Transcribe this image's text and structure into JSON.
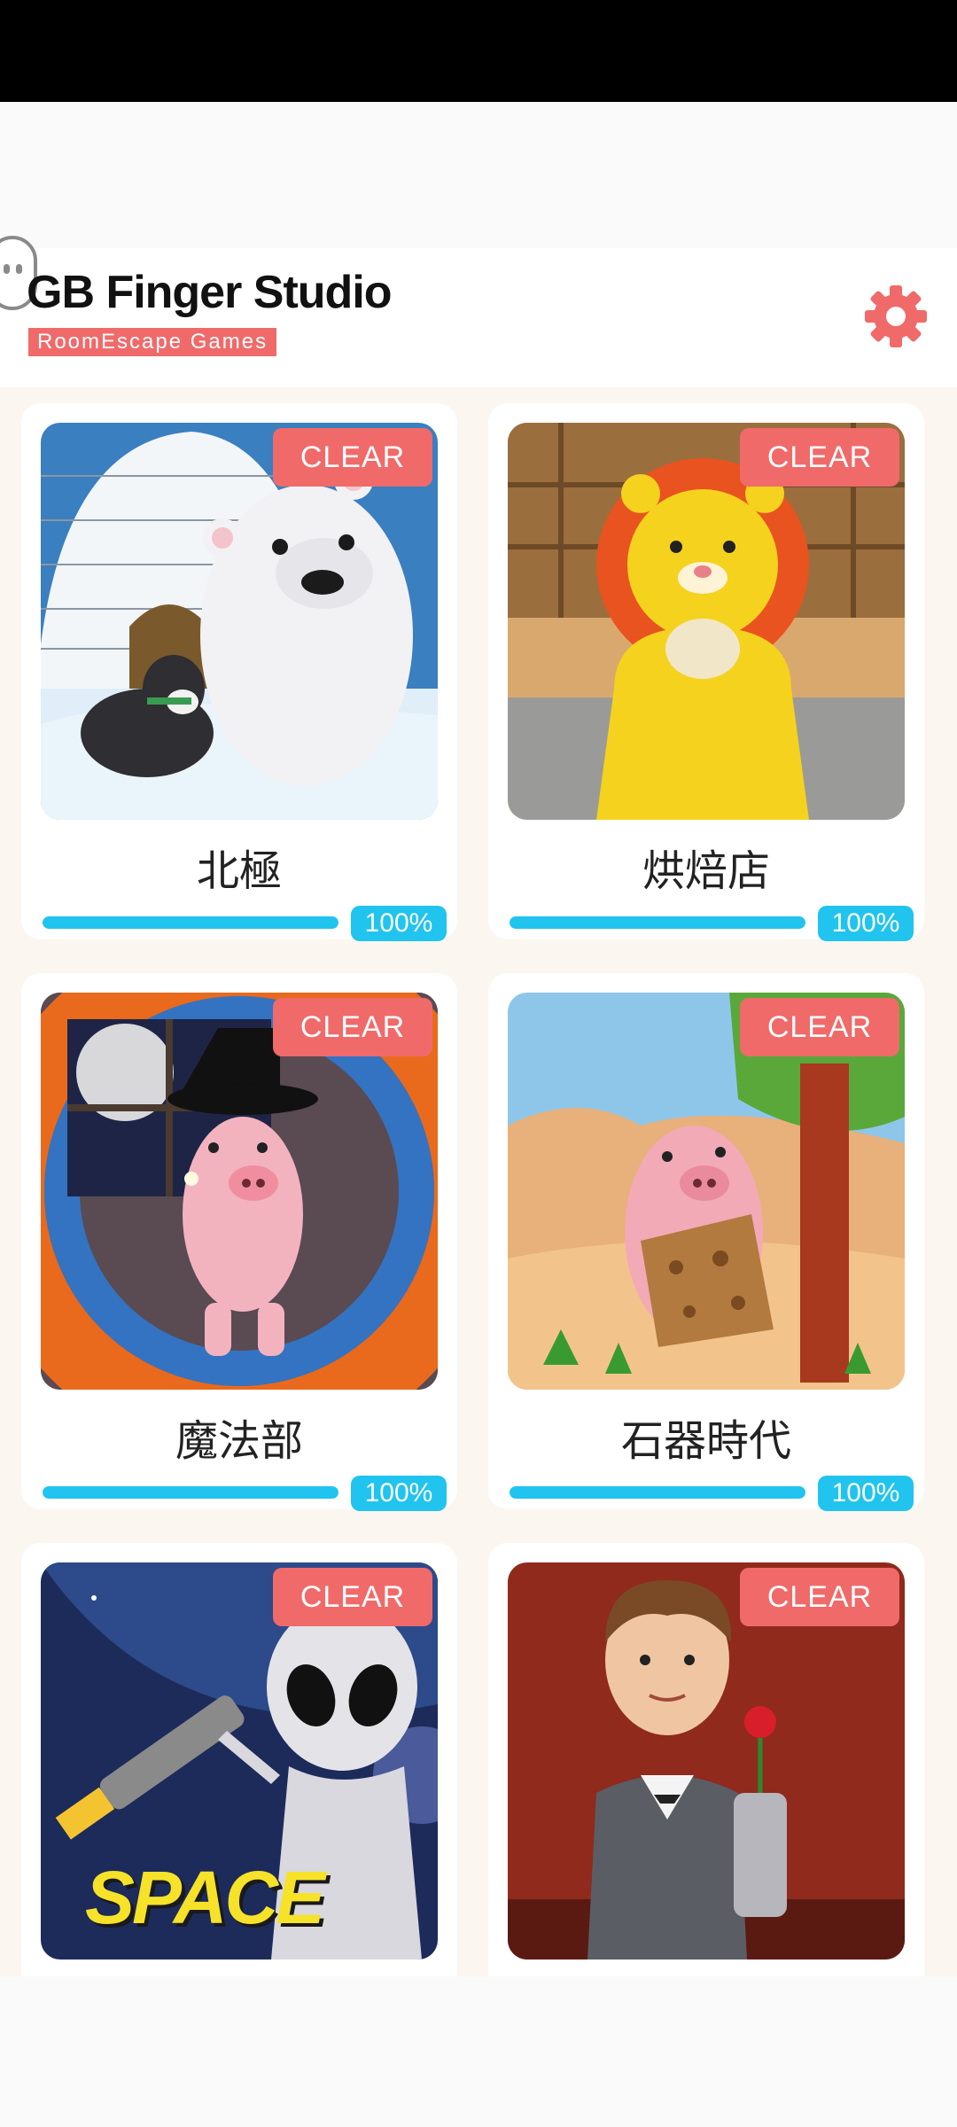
{
  "header": {
    "title": "GB Finger Studio",
    "subtitle": "RoomEscape Games",
    "settings_icon": "gear-icon",
    "accent_color": "#f06a6a"
  },
  "games": [
    {
      "title": "北極",
      "badge": "CLEAR",
      "progress_label": "100%",
      "progress": 1.0
    },
    {
      "title": "烘焙店",
      "badge": "CLEAR",
      "progress_label": "100%",
      "progress": 1.0
    },
    {
      "title": "魔法部",
      "badge": "CLEAR",
      "progress_label": "100%",
      "progress": 1.0
    },
    {
      "title": "石器時代",
      "badge": "CLEAR",
      "progress_label": "100%",
      "progress": 1.0
    },
    {
      "title": "",
      "badge": "CLEAR",
      "thumb_text": "SPACE"
    },
    {
      "title": "",
      "badge": "CLEAR"
    }
  ],
  "colors": {
    "progress": "#20c4ee",
    "badge": "#f06a6a",
    "background": "#fcf6f0"
  }
}
